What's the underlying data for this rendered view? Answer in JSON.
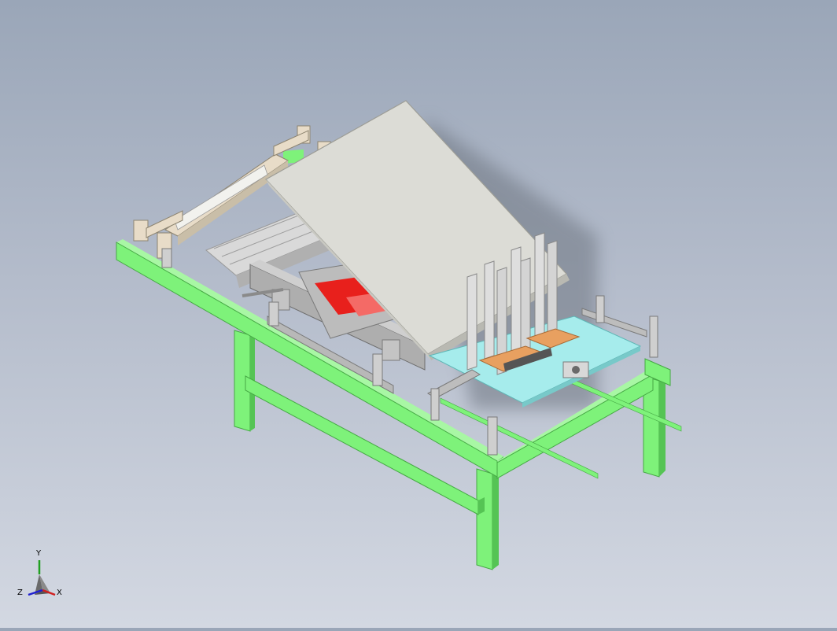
{
  "viewport": {
    "background_top": "#9aa6b8",
    "background_bottom": "#d3d8e2"
  },
  "model": {
    "colors": {
      "frame_green": "#7ef27a",
      "frame_green_dark": "#55c454",
      "frame_green_light": "#a8f7a4",
      "cover_panel": "#dcdcd6",
      "cover_edge": "#b9b9b2",
      "roller_beige": "#e8dcc8",
      "part_gray": "#b8b8b8",
      "part_dark": "#8a8a8a",
      "accent_red": "#e8201c",
      "accent_orange": "#e8a060",
      "tray_cyan": "#a6ecec",
      "shadow": "#6d7480"
    }
  },
  "triad": {
    "x_label": "X",
    "y_label": "Y",
    "z_label": "Z",
    "x_color": "#d02020",
    "y_color": "#20a020",
    "z_color": "#2020d0"
  }
}
